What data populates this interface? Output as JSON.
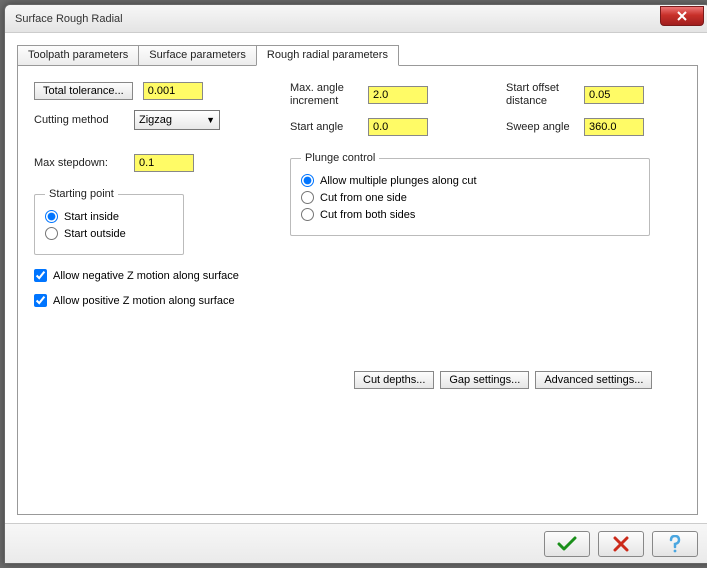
{
  "window": {
    "title": "Surface Rough Radial"
  },
  "tabs": [
    {
      "label": "Toolpath parameters"
    },
    {
      "label": "Surface parameters"
    },
    {
      "label": "Rough radial parameters"
    }
  ],
  "toleranceBtn": "Total tolerance...",
  "tolerance": "0.001",
  "cuttingMethodLabel": "Cutting method",
  "cuttingMethod": "Zigzag",
  "maxStepdownLabel": "Max stepdown:",
  "maxStepdown": "0.1",
  "maxAngleLabel": "Max. angle increment",
  "maxAngle": "2.0",
  "startAngleLabel": "Start angle",
  "startAngle": "0.0",
  "startOffsetLabel": "Start offset distance",
  "startOffset": "0.05",
  "sweepAngleLabel": "Sweep angle",
  "sweepAngle": "360.0",
  "startingPoint": {
    "legend": "Starting point",
    "inside": "Start inside",
    "outside": "Start outside"
  },
  "plunge": {
    "legend": "Plunge control",
    "multiple": "Allow multiple plunges along cut",
    "oneSide": "Cut from one side",
    "bothSides": "Cut from both sides"
  },
  "negZ": "Allow negative Z motion along surface",
  "posZ": "Allow positive Z motion along surface",
  "cutDepthsBtn": "Cut depths...",
  "gapSettingsBtn": "Gap settings...",
  "advancedBtn": "Advanced settings..."
}
